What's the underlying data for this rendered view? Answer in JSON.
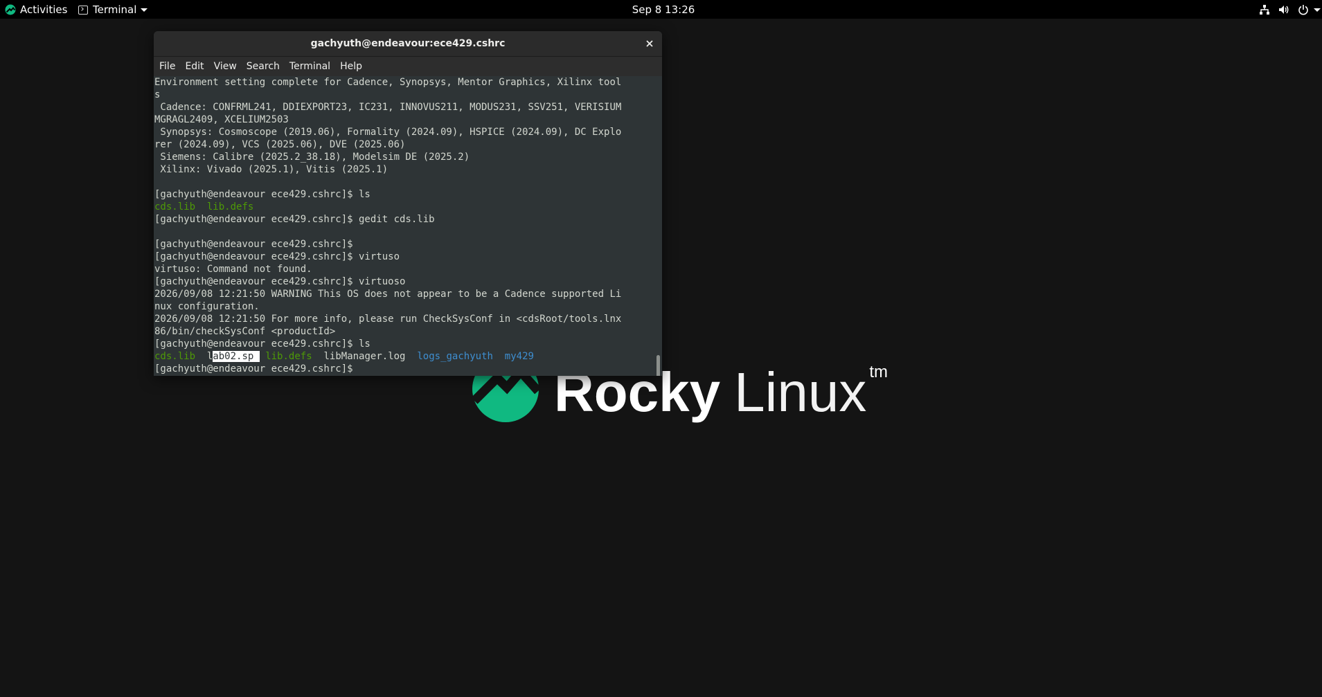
{
  "topbar": {
    "activities": "Activities",
    "app_menu": "Terminal",
    "clock": "Sep 8  13:26"
  },
  "wallpaper": {
    "word1": "Rocky",
    "word2": "Linux",
    "tm": "tm"
  },
  "window": {
    "title": "gachyuth@endeavour:ece429.cshrc",
    "menu": [
      "File",
      "Edit",
      "View",
      "Search",
      "Terminal",
      "Help"
    ]
  },
  "terminal": {
    "lines": [
      "Environment setting complete for Cadence, Synopsys, Mentor Graphics, Xilinx tool",
      "s",
      " Cadence: CONFRML241, DDIEXPORT23, IC231, INNOVUS211, MODUS231, SSV251, VERISIUM",
      "MGRAGL2409, XCELIUM2503",
      " Synopsys: Cosmoscope (2019.06), Formality (2024.09), HSPICE (2024.09), DC Explo",
      "rer (2024.09), VCS (2025.06), DVE (2025.06)",
      " Siemens: Calibre (2025.2_38.18), Modelsim DE (2025.2)",
      " Xilinx: Vivado (2025.1), Vitis (2025.1)",
      "",
      "[gachyuth@endeavour ece429.cshrc]$ ls",
      "__LS1__",
      "[gachyuth@endeavour ece429.cshrc]$ gedit cds.lib",
      "",
      "[gachyuth@endeavour ece429.cshrc]$",
      "[gachyuth@endeavour ece429.cshrc]$ virtuso",
      "virtuso: Command not found.",
      "[gachyuth@endeavour ece429.cshrc]$ virtuoso",
      "2026/09/08 12:21:50 WARNING This OS does not appear to be a Cadence supported Li",
      "nux configuration.",
      "2026/09/08 12:21:50 For more info, please run CheckSysConf in <cdsRoot/tools.lnx",
      "86/bin/checkSysConf <productId>",
      "[gachyuth@endeavour ece429.cshrc]$ ls",
      "__LS2__",
      "[gachyuth@endeavour ece429.cshrc]$ "
    ],
    "ls1": {
      "cds_lib": "cds.lib",
      "lib_defs": "lib.defs"
    },
    "ls2": {
      "cds_lib": "cds.lib",
      "lab_l": "l",
      "lab_rest": "ab02.sp ",
      "lib_defs": "lib.defs",
      "libmanager": "libManager.log",
      "logs": "logs_gachyuth",
      "my429": "my429"
    }
  },
  "colors": {
    "terminal_bg": "#2e3436",
    "terminal_fg": "#d3d7cf",
    "green": "#4e9a06",
    "blue": "#3e8ed0",
    "rocky_green": "#10b981"
  }
}
